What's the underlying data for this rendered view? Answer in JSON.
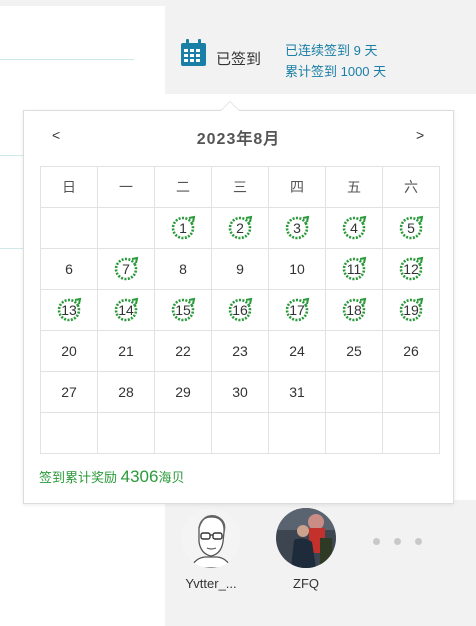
{
  "signin": {
    "status": "已签到",
    "streak_text": "已连续签到 9 天",
    "total_text": "累计签到 1000 天"
  },
  "calendar": {
    "prev": "<",
    "next": ">",
    "title": "2023年8月",
    "weekdays": [
      "日",
      "一",
      "二",
      "三",
      "四",
      "五",
      "六"
    ],
    "weeks": [
      [
        {
          "d": ""
        },
        {
          "d": ""
        },
        {
          "d": "1",
          "signed": true
        },
        {
          "d": "2",
          "signed": true
        },
        {
          "d": "3",
          "signed": true
        },
        {
          "d": "4",
          "signed": true
        },
        {
          "d": "5",
          "signed": true
        }
      ],
      [
        {
          "d": "6"
        },
        {
          "d": "7",
          "signed": true
        },
        {
          "d": "8"
        },
        {
          "d": "9"
        },
        {
          "d": "10"
        },
        {
          "d": "11",
          "signed": true
        },
        {
          "d": "12",
          "signed": true
        }
      ],
      [
        {
          "d": "13",
          "signed": true
        },
        {
          "d": "14",
          "signed": true
        },
        {
          "d": "15",
          "signed": true
        },
        {
          "d": "16",
          "signed": true
        },
        {
          "d": "17",
          "signed": true
        },
        {
          "d": "18",
          "signed": true
        },
        {
          "d": "19",
          "signed": true
        }
      ],
      [
        {
          "d": "20"
        },
        {
          "d": "21"
        },
        {
          "d": "22"
        },
        {
          "d": "23"
        },
        {
          "d": "24"
        },
        {
          "d": "25"
        },
        {
          "d": "26"
        }
      ],
      [
        {
          "d": "27"
        },
        {
          "d": "28"
        },
        {
          "d": "29"
        },
        {
          "d": "30"
        },
        {
          "d": "31"
        },
        {
          "d": ""
        },
        {
          "d": ""
        }
      ],
      [
        {
          "d": ""
        },
        {
          "d": ""
        },
        {
          "d": ""
        },
        {
          "d": ""
        },
        {
          "d": ""
        },
        {
          "d": ""
        },
        {
          "d": ""
        }
      ]
    ],
    "reward_prefix": "签到累计奖励",
    "reward_value": "4306",
    "reward_unit": "海贝"
  },
  "users": [
    {
      "name": "Yvtter_..."
    },
    {
      "name": "ZFQ"
    }
  ],
  "colors": {
    "accent_blue": "#1a7fa6",
    "stamp_green": "#2a9a3a"
  }
}
